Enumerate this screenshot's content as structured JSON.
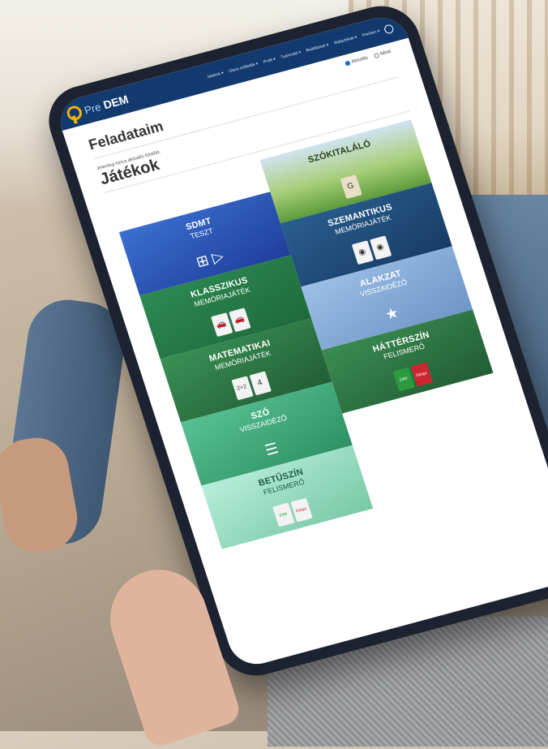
{
  "app": {
    "logo_pre": "Pre",
    "logo_dem": "DEM"
  },
  "nav": {
    "items": [
      "Játékok ▾",
      "Ülyes erőltetők ▾",
      "Profil ▾",
      "Tudnivaló ▾",
      "Beállítások ▾",
      "Statisztikák ▾",
      "PreDem ▾"
    ]
  },
  "radio": {
    "option1": "Aktuális",
    "option2": "Mind",
    "selected": "Aktuális"
  },
  "page": {
    "title": "Feladataim",
    "hint": "Jelenleg nincs aktuális feladat.",
    "section": "Játékok"
  },
  "tiles": [
    {
      "line1": "SDMT",
      "line2": "TESZT",
      "icon": "plus-greater-icon",
      "color": "#2a56b8"
    },
    {
      "line1": "SZÓKITALÁLÓ",
      "line2": "",
      "icon": "letter-g-card-icon",
      "color": "#8bbf5b"
    },
    {
      "line1": "SZEMANTIKUS",
      "line2": "MEMÓRIAJÁTÉK",
      "icon": "cards-icon",
      "color": "#1e4f7f"
    },
    {
      "line1": "KLASSZIKUS",
      "line2": "MEMÓRIAJÁTÉK",
      "icon": "cards-icon",
      "color": "#237a48"
    },
    {
      "line1": "ALAKZAT",
      "line2": "VISSZAIDÉZŐ",
      "icon": "head-star-icon",
      "color": "#8aaed9"
    },
    {
      "line1": "MATEMATIKAI",
      "line2": "MEMÓRIAJÁTÉK",
      "icon": "cards-icon",
      "color": "#2f7e46"
    },
    {
      "line1": "HÁTTÉRSZÍN",
      "line2": "FELISMERŐ",
      "icon": "color-cards-icon",
      "color": "#2e7d44"
    },
    {
      "line1": "SZÓ",
      "line2": "VISSZAIDÉZŐ",
      "icon": "head-lines-icon",
      "color": "#4bb083"
    },
    {
      "line1": "BETŰSZÍN",
      "line2": "FELISMERŐ",
      "icon": "color-cards-icon",
      "color": "#88d0b2"
    }
  ],
  "cards": {
    "g_letter": "G",
    "math_a": "2+2",
    "math_b": "4",
    "green_label": "Zöld",
    "red_label": "Sárga"
  }
}
